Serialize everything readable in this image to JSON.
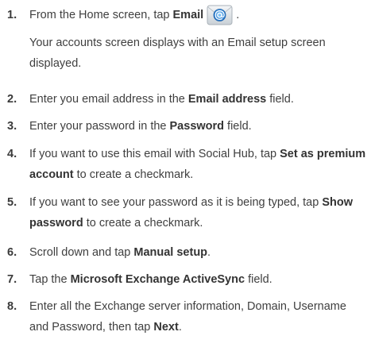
{
  "steps": [
    {
      "num": "1.",
      "parts": [
        "From the Home screen, tap ",
        "Email",
        " ."
      ],
      "note": "Your accounts screen displays with an Email setup screen displayed."
    },
    {
      "num": "2.",
      "parts": [
        "Enter you email address in the ",
        "Email address",
        " field."
      ]
    },
    {
      "num": "3.",
      "parts": [
        "Enter your password in the ",
        "Password",
        " field."
      ]
    },
    {
      "num": "4.",
      "parts": [
        "If you want to use this email with Social Hub, tap ",
        "Set as premium account",
        " to create a checkmark."
      ]
    },
    {
      "num": "5.",
      "parts": [
        "If you want to see your password as it is being typed, tap ",
        "Show password",
        " to create a checkmark."
      ]
    },
    {
      "num": "6.",
      "parts": [
        "Scroll down and tap ",
        "Manual setup",
        "."
      ]
    },
    {
      "num": "7.",
      "parts": [
        "Tap the ",
        "Microsoft Exchange ActiveSync",
        " field."
      ]
    },
    {
      "num": "8.",
      "parts": [
        "Enter all the Exchange server information, Domain, Username and Password, then tap ",
        "Next",
        "."
      ]
    }
  ],
  "icons": {
    "email": "email-icon"
  }
}
